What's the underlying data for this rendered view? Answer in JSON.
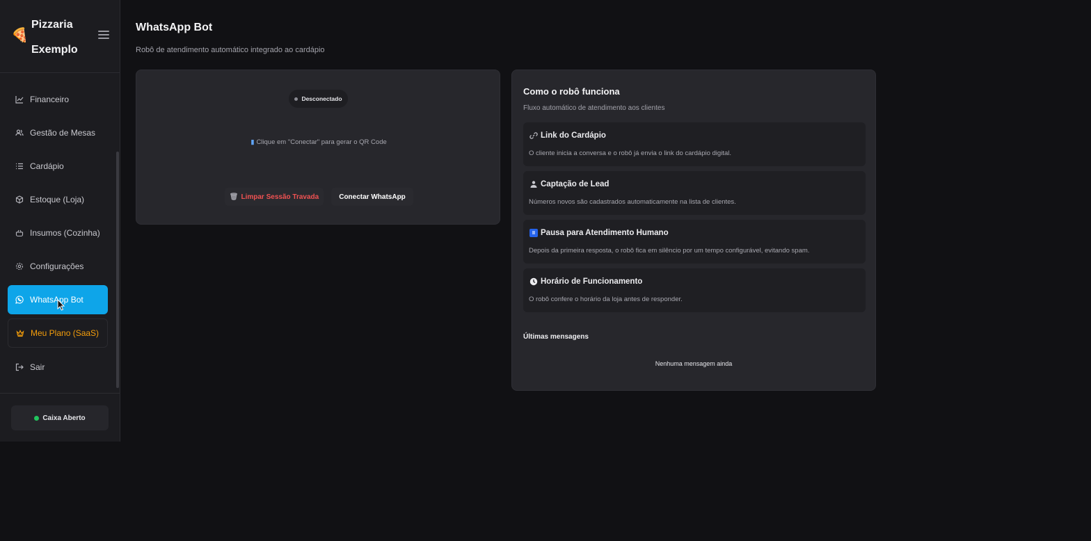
{
  "sidebar": {
    "brand_line1": "Pizzaria",
    "brand_line2": "Exemplo",
    "logo_icon": "pizza-slice",
    "items": [
      {
        "label": "Financeiro",
        "icon": "chart-line-icon"
      },
      {
        "label": "Gestão de Mesas",
        "icon": "users-icon"
      },
      {
        "label": "Cardápio",
        "icon": "list-icon"
      },
      {
        "label": "Estoque (Loja)",
        "icon": "box-icon"
      },
      {
        "label": "Insumos (Cozinha)",
        "icon": "pot-icon"
      },
      {
        "label": "Configurações",
        "icon": "gear-icon"
      },
      {
        "label": "WhatsApp Bot",
        "icon": "whatsapp-icon",
        "active": true
      },
      {
        "label": "Meu Plano (SaaS)",
        "icon": "crown-icon"
      },
      {
        "label": "Sair",
        "icon": "logout-icon"
      }
    ],
    "cash_status": "Caixa Aberto"
  },
  "header": {
    "title": "WhatsApp Bot",
    "subtitle": "Robô de atendimento automático integrado ao cardápio"
  },
  "connection": {
    "status": "Desconectado",
    "hint": "Clique em \"Conectar\" para gerar o QR Code",
    "clear_label": "Limpar Sessão Travada",
    "connect_label": "Conectar WhatsApp"
  },
  "info": {
    "title": "Como o robô funciona",
    "subtitle": "Fluxo automático de atendimento aos clientes",
    "features": [
      {
        "title": "Link do Cardápio",
        "desc": "O cliente inicia a conversa e o robô já envia o link do cardápio digital.",
        "icon": "link-icon"
      },
      {
        "title": "Captação de Lead",
        "desc": "Números novos são cadastrados automaticamente na lista de clientes.",
        "icon": "user-icon"
      },
      {
        "title": "Pausa para Atendimento Humano",
        "desc": "Depois da primeira resposta, o robô fica em silêncio por um tempo configurável, evitando spam.",
        "icon": "pause-icon"
      },
      {
        "title": "Horário de Funcionamento",
        "desc": "O robô confere o horário da loja antes de responder.",
        "icon": "clock-icon"
      }
    ],
    "last_messages_title": "Últimas mensagens",
    "empty_messages": "Nenhuma mensagem ainda"
  },
  "colors": {
    "accent": "#0ea5e9",
    "plan": "#f59e0b",
    "danger": "#f05252",
    "online": "#22c55e"
  }
}
